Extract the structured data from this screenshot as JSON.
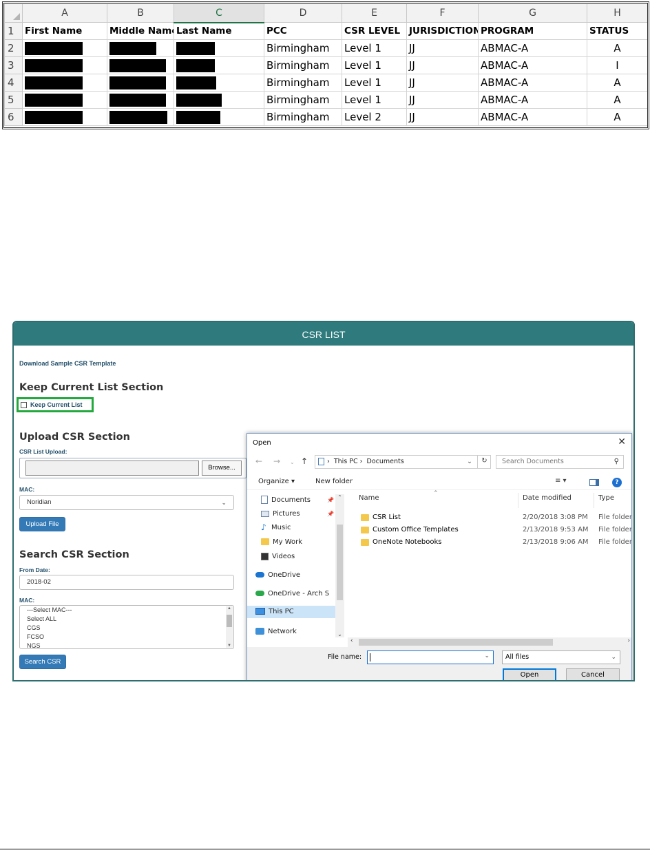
{
  "spreadsheet": {
    "columns": [
      "A",
      "B",
      "C",
      "D",
      "E",
      "F",
      "G",
      "H"
    ],
    "headers": [
      "First Name",
      "Middle Name",
      "Last Name",
      "PCC",
      "CSR LEVEL",
      "JURISDICTION",
      "PROGRAM",
      "STATUS"
    ],
    "rows": [
      {
        "num": "1"
      },
      {
        "num": "2",
        "pcc": "Birmingham",
        "level": "Level 1",
        "jurisdiction": "JJ",
        "program": "ABMAC-A",
        "status": "A"
      },
      {
        "num": "3",
        "pcc": "Birmingham",
        "level": "Level 1",
        "jurisdiction": "JJ",
        "program": "ABMAC-A",
        "status": "I"
      },
      {
        "num": "4",
        "pcc": "Birmingham",
        "level": "Level 1",
        "jurisdiction": "JJ",
        "program": "ABMAC-A",
        "status": "A"
      },
      {
        "num": "5",
        "pcc": "Birmingham",
        "level": "Level 1",
        "jurisdiction": "JJ",
        "program": "ABMAC-A",
        "status": "A"
      },
      {
        "num": "6",
        "pcc": "Birmingham",
        "level": "Level 2",
        "jurisdiction": "JJ",
        "program": "ABMAC-A",
        "status": "A"
      }
    ]
  },
  "csr": {
    "title": "CSR LIST",
    "download_link": "Download Sample CSR Template",
    "keep_section_title": "Keep Current List Section",
    "keep_checkbox_label": "Keep Current List",
    "upload_section_title": "Upload CSR Section",
    "upload_label": "CSR List Upload:",
    "browse_label": "Browse...",
    "mac_label": "MAC:",
    "mac_value": "Noridian",
    "upload_button": "Upload File",
    "search_section_title": "Search CSR Section",
    "from_date_label": "From Date:",
    "from_date_value": "2018-02",
    "mac_list_label": "MAC:",
    "mac_options": [
      "---Select MAC---",
      "Select ALL",
      "CGS",
      "FCSO",
      "NGS"
    ],
    "search_button": "Search CSR"
  },
  "dialog": {
    "title": "Open",
    "breadcrumb": [
      "This PC",
      "Documents"
    ],
    "search_placeholder": "Search Documents",
    "organize": "Organize",
    "new_folder": "New folder",
    "nav_items": [
      {
        "label": "Documents",
        "icon": "documents-icon"
      },
      {
        "label": "Pictures",
        "icon": "pictures-icon"
      },
      {
        "label": "Music",
        "icon": "music-icon"
      },
      {
        "label": "My Work",
        "icon": "folder-icon"
      },
      {
        "label": "Videos",
        "icon": "videos-icon"
      },
      {
        "label": "OneDrive",
        "icon": "onedrive-icon"
      },
      {
        "label": "OneDrive - Arch S",
        "icon": "onedrive-business-icon"
      },
      {
        "label": "This PC",
        "icon": "computer-icon"
      },
      {
        "label": "Network",
        "icon": "network-icon"
      }
    ],
    "col_name": "Name",
    "col_date": "Date modified",
    "col_type": "Type",
    "files": [
      {
        "name": "CSR List",
        "date": "2/20/2018 3:08 PM",
        "type": "File folder"
      },
      {
        "name": "Custom Office Templates",
        "date": "2/13/2018 9:53 AM",
        "type": "File folder"
      },
      {
        "name": "OneNote Notebooks",
        "date": "2/13/2018 9:06 AM",
        "type": "File folder"
      }
    ],
    "file_name_label": "File name:",
    "file_type": "All files",
    "open_button": "Open",
    "cancel_button": "Cancel"
  }
}
